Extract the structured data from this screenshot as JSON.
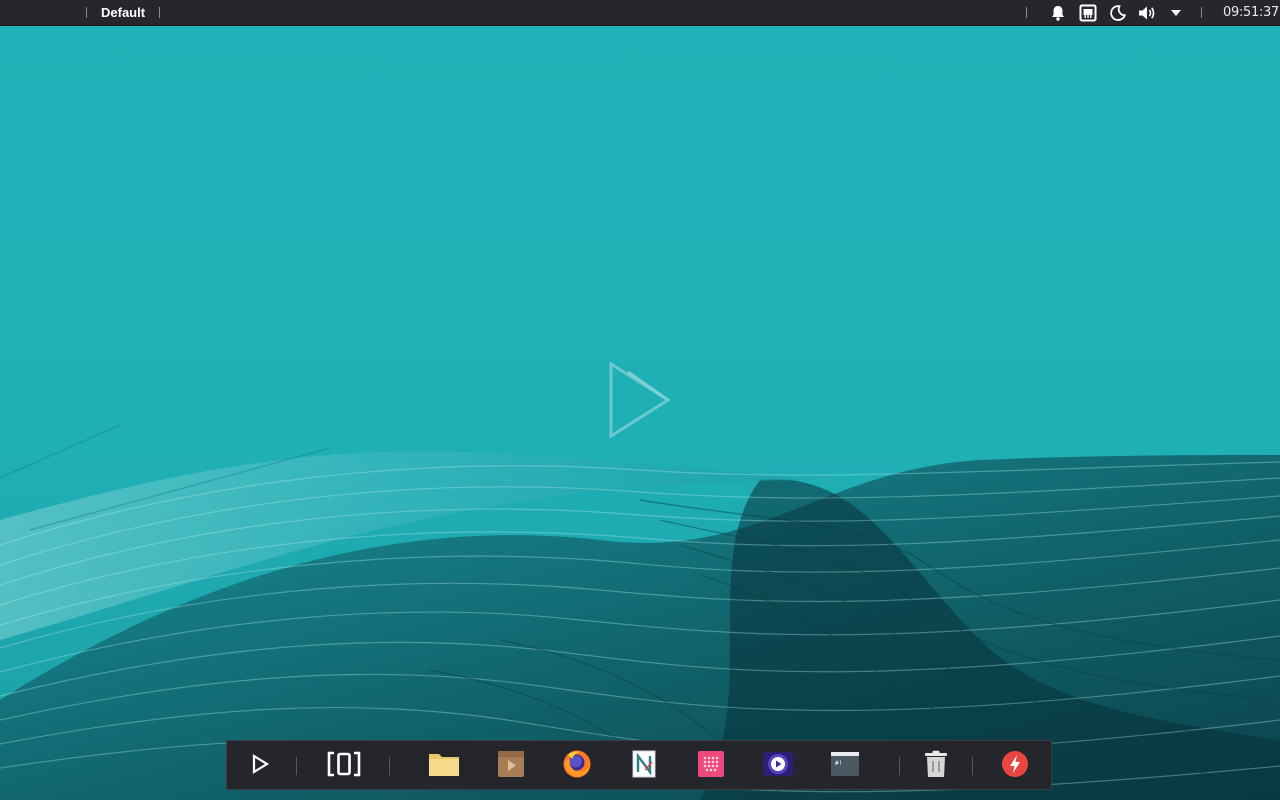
{
  "top_panel": {
    "workspace": "Default",
    "clock": "09:51:37",
    "tray": [
      {
        "name": "notifications",
        "icon": "bell-icon"
      },
      {
        "name": "network",
        "icon": "ethernet-icon"
      },
      {
        "name": "night-light",
        "icon": "moon-icon"
      },
      {
        "name": "volume",
        "icon": "speaker-icon"
      },
      {
        "name": "menu",
        "icon": "triangle-down-icon"
      }
    ]
  },
  "dock": {
    "items": [
      {
        "name": "app-launcher",
        "icon": "play-outline-icon"
      },
      {
        "name": "workspace-overview",
        "icon": "brackets-icon"
      },
      {
        "name": "file-manager",
        "icon": "folder-icon"
      },
      {
        "name": "package-installer",
        "icon": "package-icon"
      },
      {
        "name": "firefox",
        "icon": "firefox-icon"
      },
      {
        "name": "text-editor",
        "icon": "notes-icon"
      },
      {
        "name": "software-center",
        "icon": "grid-dots-icon"
      },
      {
        "name": "media-player",
        "icon": "media-play-icon"
      },
      {
        "name": "terminal",
        "icon": "terminal-icon"
      },
      {
        "name": "trash",
        "icon": "trash-icon"
      },
      {
        "name": "power-menu",
        "icon": "power-bolt-icon"
      }
    ]
  },
  "colors": {
    "panel": "#26272d",
    "wallpaper": "#20b0b7",
    "accent_red": "#e8463f"
  }
}
